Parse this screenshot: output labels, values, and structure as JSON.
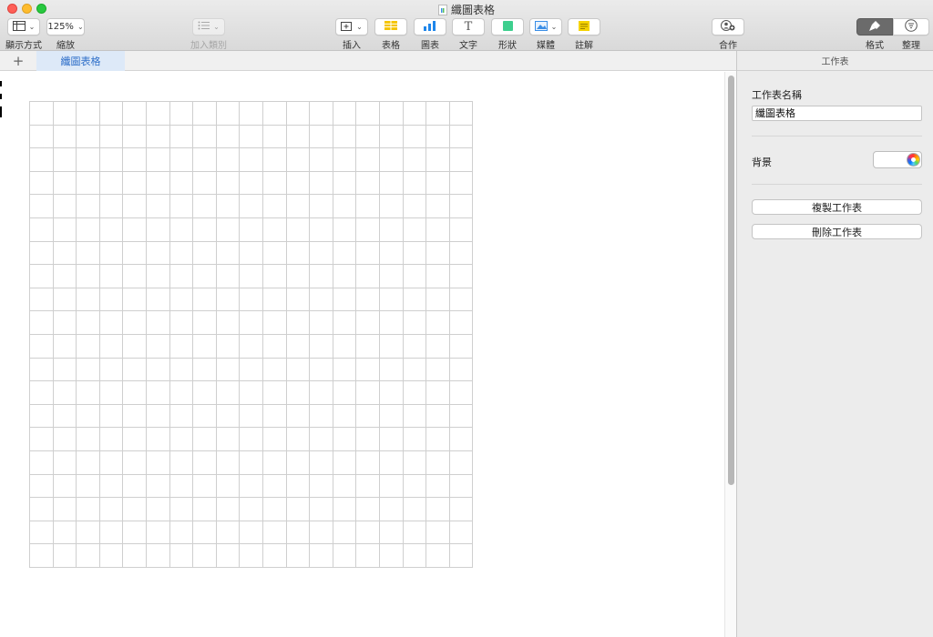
{
  "window": {
    "title": "纖圖表格"
  },
  "toolbar": {
    "view": {
      "label": "顯示方式"
    },
    "zoom": {
      "value": "125%",
      "label": "縮放"
    },
    "add_category": {
      "label": "加入類別"
    },
    "insert": {
      "label": "插入"
    },
    "table": {
      "label": "表格"
    },
    "chart": {
      "label": "圖表"
    },
    "text": {
      "label": "文字",
      "glyph": "T"
    },
    "shape": {
      "label": "形狀"
    },
    "media": {
      "label": "媒體"
    },
    "comment": {
      "label": "註解"
    },
    "collaborate": {
      "label": "合作"
    },
    "format": {
      "label": "格式"
    },
    "organize": {
      "label": "整理"
    }
  },
  "tabs": {
    "add_glyph": "+",
    "sheets": [
      {
        "label": "纖圖表格",
        "active": true
      }
    ]
  },
  "canvas": {
    "grid_rows": 20,
    "grid_cols": 19
  },
  "inspector": {
    "header": "工作表",
    "sheet_name_label": "工作表名稱",
    "sheet_name_value": "纖圖表格",
    "background_label": "背景",
    "duplicate_button": "複製工作表",
    "delete_button": "刪除工作表"
  },
  "colors": {
    "accent": "#2f6fc9",
    "active_tab_bg": "#dde9f8",
    "close": "#fe5f57",
    "minimize": "#febc2e",
    "zoom": "#28c840",
    "table_icon": "#f5c400",
    "chart_icon": "#1f86ea",
    "shape_icon": "#3ecf8e",
    "comment_icon": "#f5d300"
  },
  "icons": [
    "view-icon",
    "add-category-icon",
    "insert-icon",
    "table-icon",
    "chart-icon",
    "text-icon",
    "shape-icon",
    "media-icon",
    "comment-icon",
    "collaborate-icon",
    "format-brush-icon",
    "organize-icon",
    "color-wheel-icon",
    "add-sheet-icon"
  ]
}
